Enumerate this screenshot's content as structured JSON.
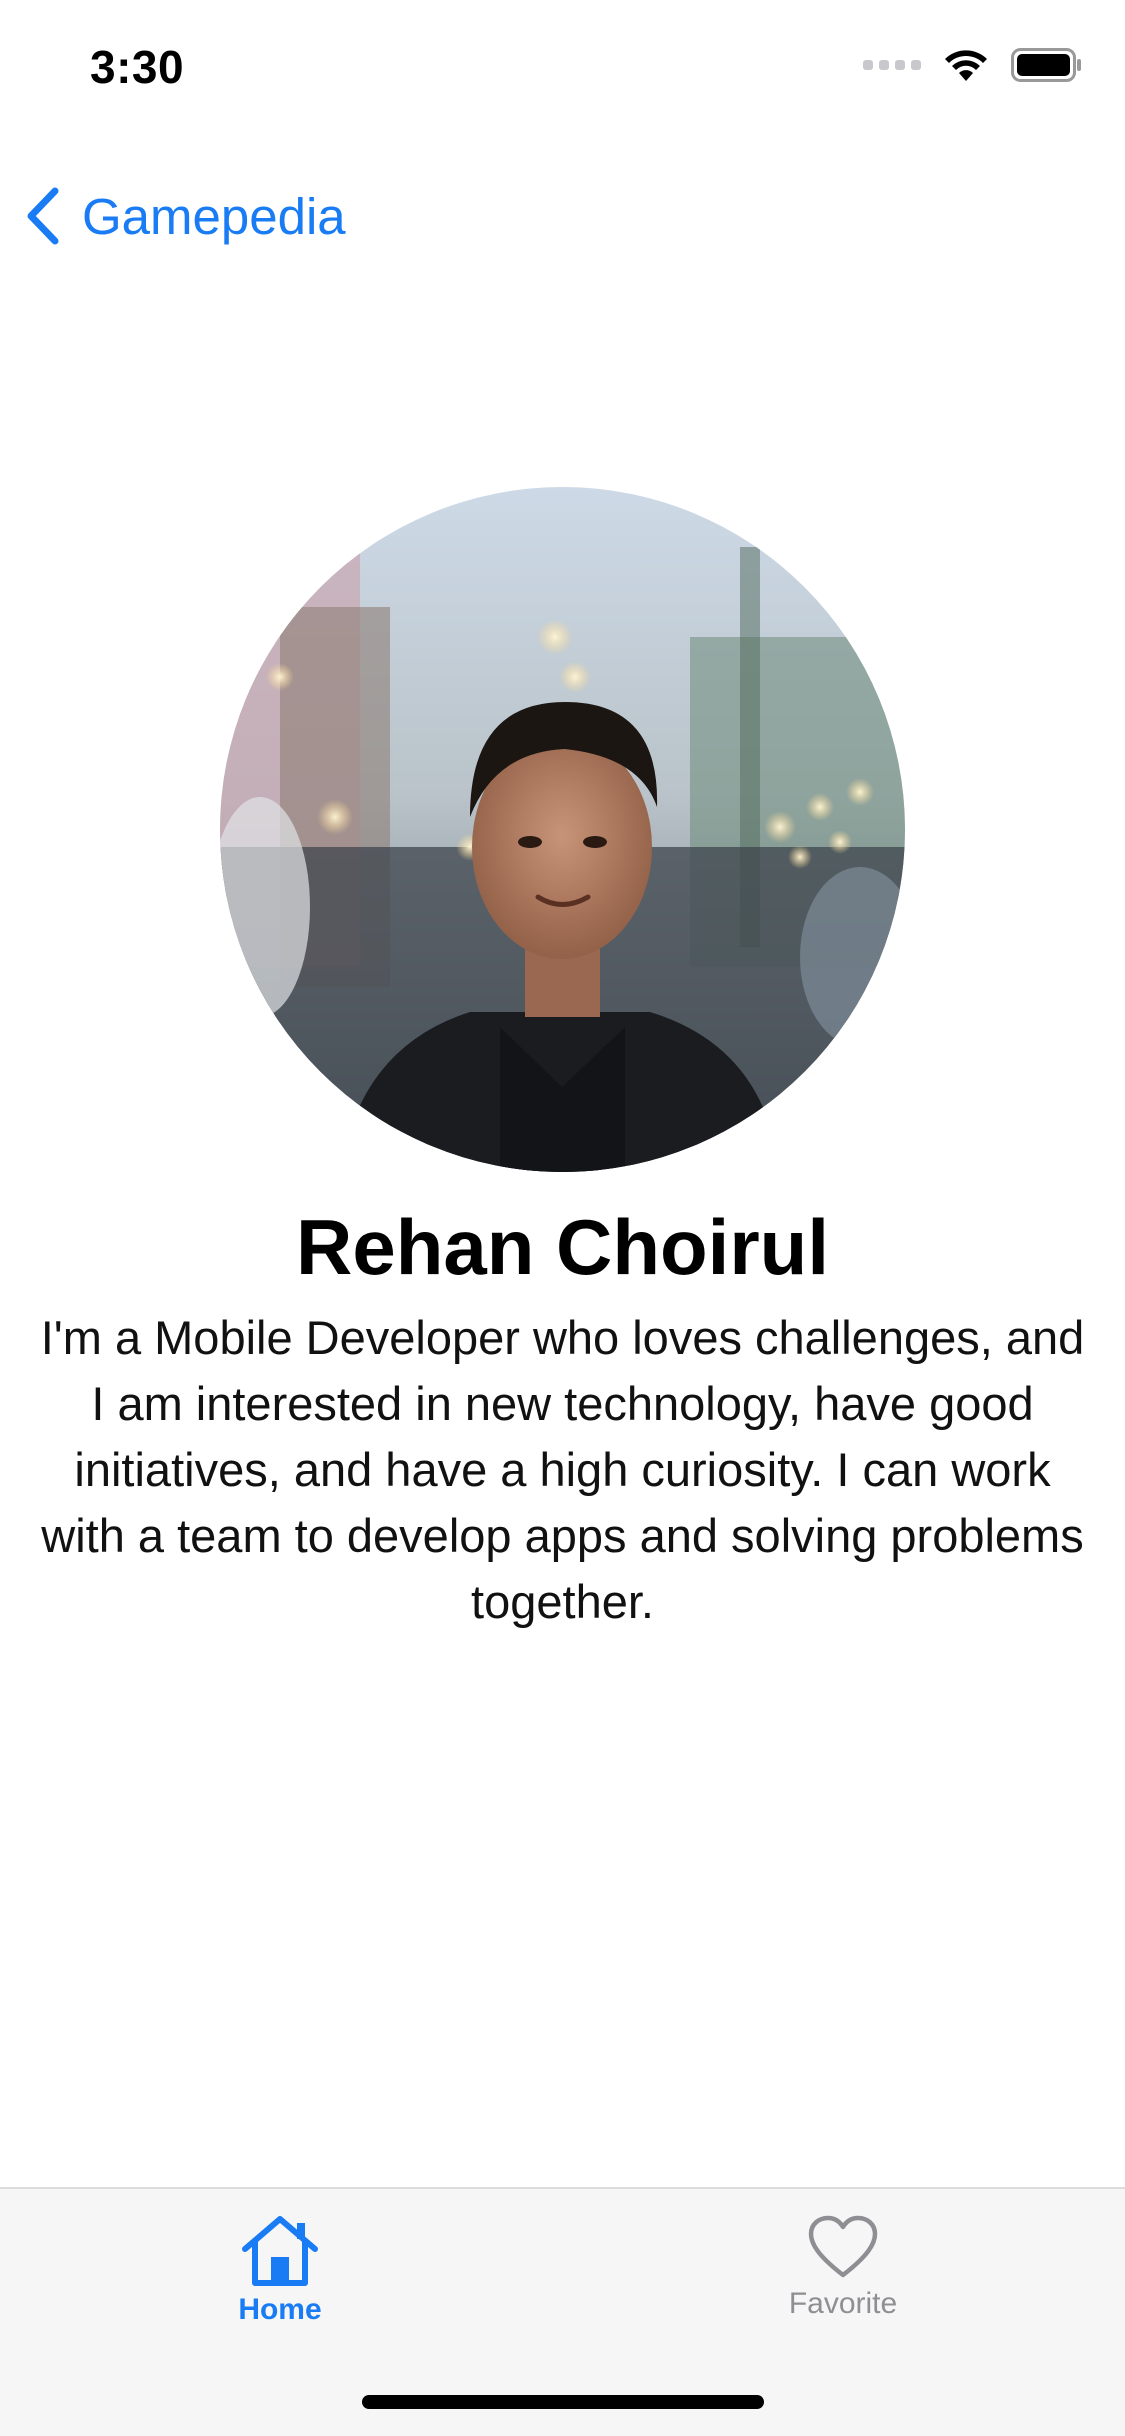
{
  "status_bar": {
    "time": "3:30",
    "icons": [
      "signal-icon",
      "wifi-icon",
      "battery-icon"
    ]
  },
  "nav": {
    "back_label": "Gamepedia",
    "back_icon": "chevron-left-icon",
    "accent_color": "#1a7cf4"
  },
  "profile": {
    "avatar": "profile-photo",
    "name": "Rehan Choirul",
    "bio": "I'm a Mobile Developer who loves challenges, and I am interested in new technology, have good initiatives, and have a high curiosity. I can work with a team to develop apps and solving problems together."
  },
  "tab_bar": {
    "tabs": [
      {
        "label": "Home",
        "icon": "house-icon",
        "active": true
      },
      {
        "label": "Favorite",
        "icon": "heart-icon",
        "active": false
      }
    ],
    "active_color": "#1a7cf4",
    "inactive_color": "#8e8e93"
  }
}
